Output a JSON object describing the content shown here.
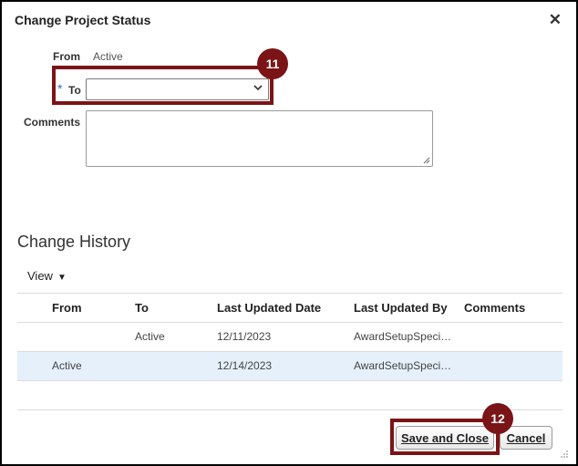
{
  "dialog": {
    "title": "Change Project Status",
    "close_symbol": "✕"
  },
  "form": {
    "from_label": "From",
    "from_value": "Active",
    "required_marker": "*",
    "to_label": "To",
    "to_value": "",
    "comments_label": "Comments",
    "comments_value": ""
  },
  "callouts": {
    "step_11": "11",
    "step_12": "12",
    "color": "#7b1416"
  },
  "history": {
    "title": "Change History",
    "view_label": "View",
    "columns": [
      "From",
      "To",
      "Last Updated Date",
      "Last Updated By",
      "Comments"
    ],
    "rows": [
      {
        "from": "",
        "to": "Active",
        "date": "12/11/2023",
        "by": "AwardSetupSpeci…",
        "comments": "",
        "selected": false
      },
      {
        "from": "Active",
        "to": "",
        "date": "12/14/2023",
        "by": "AwardSetupSpeci…",
        "comments": "",
        "selected": true
      }
    ]
  },
  "buttons": {
    "save_close": "Save and Close",
    "cancel": "Cancel"
  },
  "colors": {
    "required_star": "#2e6fc7",
    "selected_row": "#e5f0fb"
  }
}
